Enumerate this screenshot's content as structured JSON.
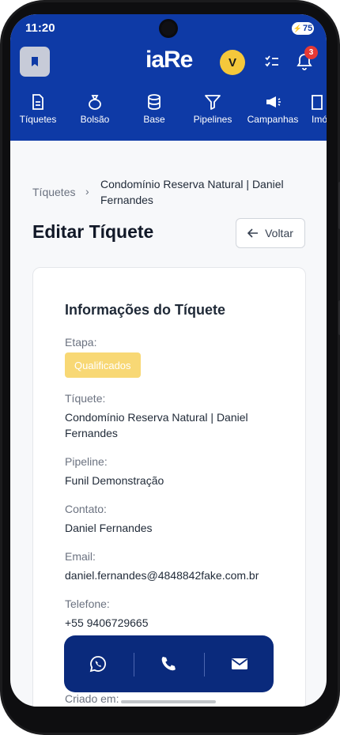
{
  "status": {
    "time": "11:20",
    "battery": "75"
  },
  "appbar": {
    "logo": "iaRe",
    "avatar_letter": "V",
    "notifications_count": "3"
  },
  "nav": {
    "items": [
      {
        "label": "Tíquetes",
        "icon": "document-icon"
      },
      {
        "label": "Bolsão",
        "icon": "money-bag-icon"
      },
      {
        "label": "Base",
        "icon": "database-icon"
      },
      {
        "label": "Pipelines",
        "icon": "filter-icon"
      },
      {
        "label": "Campanhas",
        "icon": "megaphone-icon"
      },
      {
        "label": "Imó",
        "icon": "building-icon"
      }
    ]
  },
  "breadcrumb": {
    "root": "Tíquetes",
    "separator": "›",
    "current": "Condomínio Reserva Natural | Daniel Fernandes"
  },
  "page": {
    "title": "Editar Tíquete",
    "back_label": "Voltar"
  },
  "ticket": {
    "section_title": "Informações do Tíquete",
    "stage_label": "Etapa:",
    "stage_value": "Qualificados",
    "ticket_label": "Tíquete:",
    "ticket_value": "Condomínio Reserva Natural | Daniel Fernandes",
    "pipeline_label": "Pipeline:",
    "pipeline_value": "Funil Demonstração",
    "contact_label": "Contato:",
    "contact_value": "Daniel Fernandes",
    "email_label": "Email:",
    "email_value": "daniel.fernandes@4848842fake.com.br",
    "phone_label": "Telefone:",
    "phone_value": "+55 9406729665",
    "created_label": "Criado em:"
  },
  "colors": {
    "primary": "#0e3aa6",
    "stage": "#f8d875",
    "avatar": "#f5c83b",
    "badge": "#e53935",
    "fab": "#0a2a7c"
  },
  "actions": [
    {
      "name": "whatsapp-button",
      "icon": "whatsapp-icon"
    },
    {
      "name": "call-button",
      "icon": "phone-icon"
    },
    {
      "name": "email-button",
      "icon": "mail-icon"
    }
  ]
}
